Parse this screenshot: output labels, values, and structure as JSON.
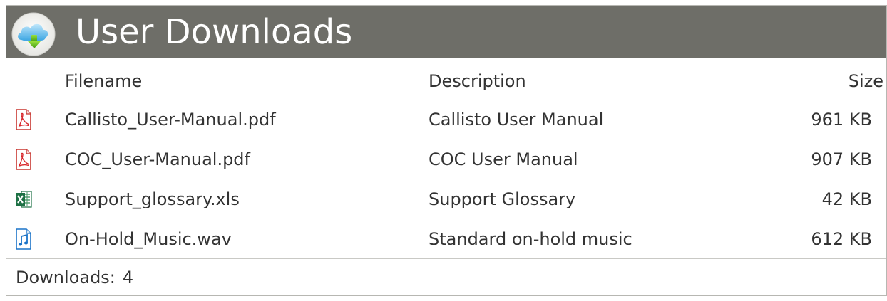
{
  "header": {
    "title": "User Downloads",
    "icon": "cloud-download-icon"
  },
  "columns": {
    "filename": "Filename",
    "description": "Description",
    "size": "Size"
  },
  "files": [
    {
      "icon": "pdf-file-icon",
      "filename": "Callisto_User-Manual.pdf",
      "description": "Callisto User Manual",
      "size": "961 KB"
    },
    {
      "icon": "pdf-file-icon",
      "filename": "COC_User-Manual.pdf",
      "description": "COC User Manual",
      "size": "907 KB"
    },
    {
      "icon": "excel-file-icon",
      "filename": "Support_glossary.xls",
      "description": "Support Glossary",
      "size": "42 KB"
    },
    {
      "icon": "audio-file-icon",
      "filename": "On-Hold_Music.wav",
      "description": "Standard on-hold music",
      "size": "612 KB"
    }
  ],
  "footer": {
    "label": "Downloads:",
    "count": "4"
  },
  "colors": {
    "header_bg": "#6e6e68",
    "pdf_red": "#d8262b",
    "excel_green": "#1e7145",
    "audio_blue": "#1a73c8"
  }
}
